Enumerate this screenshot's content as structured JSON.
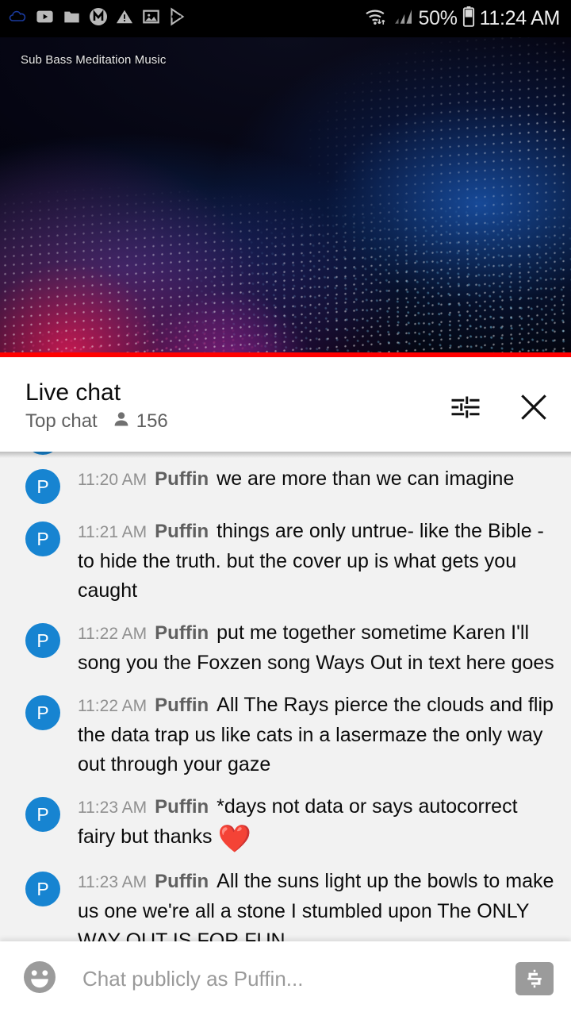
{
  "status_bar": {
    "icons": [
      "cloud-icon",
      "youtube-icon",
      "folder-icon",
      "m-circle-icon",
      "warning-triangle-icon",
      "image-icon",
      "play-store-icon"
    ],
    "wifi_icon": "wifi-icon",
    "signal_icon": "cellular-signal-icon",
    "battery_percent": "50%",
    "battery_icon": "battery-icon",
    "time": "11:24 AM"
  },
  "video": {
    "title": "Sub Bass Meditation Music",
    "progress_percent": 100,
    "progress_color": "#ff0000"
  },
  "chat_header": {
    "title": "Live chat",
    "mode": "Top chat",
    "viewer_icon": "person-icon",
    "viewers": "156",
    "filter_icon": "tune-filter-icon",
    "close_icon": "close-icon"
  },
  "messages": [
    {
      "avatar_letter": "P",
      "time": "11:20 AM",
      "author": "Puffin",
      "text": "we are more than we can imagine"
    },
    {
      "avatar_letter": "P",
      "time": "11:21 AM",
      "author": "Puffin",
      "text": "things are only untrue- like the Bible - to hide the truth. but the cover up is what gets you caught"
    },
    {
      "avatar_letter": "P",
      "time": "11:22 AM",
      "author": "Puffin",
      "text": "put me together sometime Karen I'll song you the Foxzen song Ways Out in text here goes"
    },
    {
      "avatar_letter": "P",
      "time": "11:22 AM",
      "author": "Puffin",
      "text": "All The Rays pierce the clouds and flip the data trap us like cats in a lasermaze the only way out through your gaze"
    },
    {
      "avatar_letter": "P",
      "time": "11:23 AM",
      "author": "Puffin",
      "text": "*days not data or says autocorrect fairy but thanks ",
      "emoji": "❤️"
    },
    {
      "avatar_letter": "P",
      "time": "11:23 AM",
      "author": "Puffin",
      "text": "All the suns light up the bowls to make us one we're all a stone I stumbled upon The ONLY WAY OUT IS FOR FUN"
    }
  ],
  "input_bar": {
    "emoji_icon": "emoji-smiley-icon",
    "placeholder": "Chat publicly as Puffin...",
    "superchat_icon": "super-chat-dollar-icon"
  },
  "colors": {
    "avatar_blue": "#1784d1",
    "chat_bg": "#f2f2f2",
    "progress_red": "#ff0000"
  }
}
